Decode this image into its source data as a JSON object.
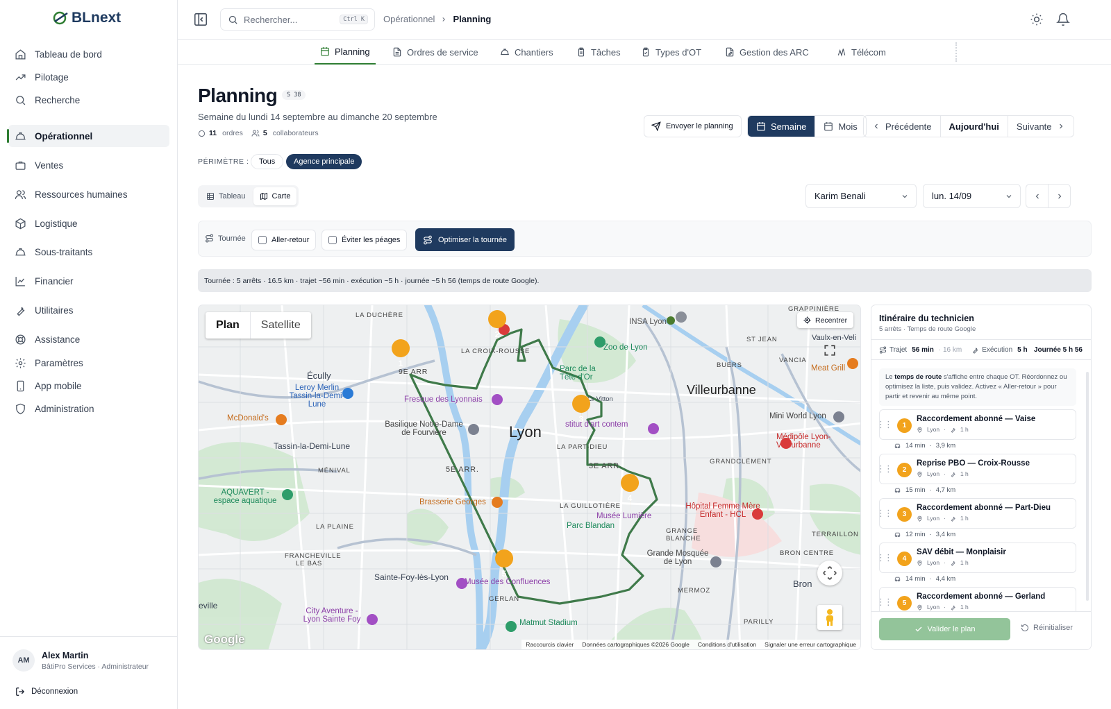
{
  "app": {
    "logo": "BLnext"
  },
  "sidebar": {
    "items": [
      {
        "label": "Tableau de bord",
        "icon": "home-icon"
      },
      {
        "label": "Pilotage",
        "icon": "trending-up-icon"
      },
      {
        "label": "Recherche",
        "icon": "search-icon"
      },
      {
        "label": "Opérationnel",
        "icon": "hard-hat-icon",
        "active": true
      },
      {
        "label": "Ventes",
        "icon": "briefcase-icon"
      },
      {
        "label": "Ressources humaines",
        "icon": "users-icon"
      },
      {
        "label": "Logistique",
        "icon": "package-icon"
      },
      {
        "label": "Sous-traitants",
        "icon": "hard-hat-icon"
      },
      {
        "label": "Financier",
        "icon": "line-chart-icon"
      },
      {
        "label": "Utilitaires",
        "icon": "wrench-icon"
      },
      {
        "label": "Assistance",
        "icon": "lifebuoy-icon"
      },
      {
        "label": "Paramètres",
        "icon": "gear-icon"
      },
      {
        "label": "App mobile",
        "icon": "smartphone-icon"
      },
      {
        "label": "Administration",
        "icon": "shield-icon"
      }
    ],
    "user": {
      "initials": "AM",
      "name": "Alex Martin",
      "role": "BâtiPro Services · Administrateur"
    },
    "logout": "Déconnexion"
  },
  "topbar": {
    "search_placeholder": "Rechercher...",
    "shortcut": "Ctrl K",
    "breadcrumb": [
      "Opérationnel",
      "Planning"
    ]
  },
  "tabs": [
    "Planning",
    "Ordres de service",
    "Chantiers",
    "Tâches",
    "Types d'OT",
    "Gestion des ARC",
    "Télécom"
  ],
  "page": {
    "title": "Planning",
    "week_badge": "S 38",
    "subtitle": "Semaine du lundi 14 septembre au dimanche 20 septembre",
    "orders_count": "11",
    "orders_label": "ordres",
    "collab_count": "5",
    "collab_label": "collaborateurs",
    "perimetre_label": "PÉRIMÈTRE :",
    "perimetre_options": [
      "Tous",
      "Agence principale"
    ],
    "send_button": "Envoyer le planning",
    "view_week": "Semaine",
    "view_month": "Mois",
    "prev": "Précédente",
    "today": "Aujourd'hui",
    "next": "Suivante",
    "display_table": "Tableau",
    "display_map": "Carte",
    "technician": "Karim Benali",
    "day": "lun. 14/09"
  },
  "tour": {
    "label": "Tournée",
    "round_trip": "Aller-retour",
    "avoid_tolls": "Éviter les péages",
    "optimize": "Optimiser la tournée",
    "summary": "Tournée : 5 arrêts · 16.5 km · trajet ~56 min · exécution ~5 h · journée ~5 h 56 (temps de route Google)."
  },
  "map": {
    "type_plan": "Plan",
    "type_satellite": "Satellite",
    "recenter": "Recentrer",
    "google": "Google",
    "attribution": [
      "Raccourcis clavier",
      "Données cartographiques ©2026 Google",
      "Conditions d'utilisation",
      "Signaler une erreur cartographique"
    ],
    "labels": {
      "lyon": "Lyon",
      "villeurbanne": "Villeurbanne",
      "la_duchere": "LA DUCHÈRE",
      "la_croix_rousse": "LA CROIX-ROUSSE",
      "st_jean": "ST JEAN",
      "buers": "BUERS",
      "vancia": "VANCIA",
      "grappiniere": "GRAPPINIÈRE",
      "vaulx": "Vaulx-en-Veli",
      "ecully": "Écully",
      "tassin": "Tassin-la-Demi-Lune",
      "la_part_dieu": "LA PART-DIEU",
      "3e": "3E ARR.",
      "5e": "5E ARR.",
      "menival": "MÉNIVAL",
      "la_plaine": "LA PLAINE",
      "grandclement": "GRANDCLÉMENT",
      "la_guillotiere": "LA GUILLOTIÈRE",
      "grange": "GRANGE BLANCHE",
      "terraillon": "TERRAILLON",
      "bron_centre": "BRON CENTRE",
      "bron": "Bron",
      "mermoz": "MERMOZ",
      "parilly": "PARILLY",
      "francheville": "FRANCHEVILLE LE BAS",
      "sainte_foy": "Sainte-Foy-lès-Lyon",
      "gerland": "GERLAN",
      "ville": "eville",
      "9e": "9E ARR",
      "zoo": "Zoo de Lyon",
      "insa": "INSA Lyon",
      "parc_tete_or": "Parc de la Tête d'Or",
      "meat_grill": "Meat Grill",
      "fresque": "Fresque des Lyonnais",
      "basilique": "Basilique Notre-Dame de Fourvière",
      "leroy": "Leroy Merlin Tassin-la-Demi-Lune",
      "mcdo": "McDonald's",
      "aquavert": "AQUAVERT - espace aquatique",
      "brasserie": "Brasserie Georges",
      "musee_lumiere": "Musée Lumière",
      "parc_blandan": "Parc Blandan",
      "hopital": "Hôpital Femme Mère Enfant - HCL",
      "mosquee": "Grande Mosquée de Lyon",
      "mini_world": "Mini World Lyon",
      "medipole": "Médipôle Lyon-Villeurbanne",
      "musee_conf": "Musée des Confluences",
      "matmut": "Matmut Stadium",
      "city_aventure": "City Aventure - Lyon Sainte Foy",
      "art_contemp": "stitut d'art contem",
      "cr_vitton": "Cr Vitton"
    },
    "stops": [
      "1",
      "2",
      "3",
      "4",
      "5"
    ]
  },
  "panel": {
    "title": "Itinéraire du technicien",
    "subtitle": "5 arrêts · Temps de route Google",
    "trajet_label": "Trajet",
    "trajet_value": "56 min",
    "trajet_km": "· 16 km",
    "exec_label": "Exécution",
    "exec_value": "5 h",
    "journee": "Journée 5 h 56",
    "note_bold": "temps de route",
    "note_pre": "Le ",
    "note_post": " s'affiche entre chaque OT. Réordonnez ou optimisez la liste, puis validez. Activez « Aller-retour » pour partir et revenir au même point.",
    "stops": [
      {
        "n": "1",
        "title": "Raccordement abonné — Vaise",
        "city": "Lyon",
        "dur": "1 h",
        "leg_time": "14 min",
        "leg_km": "3,9 km"
      },
      {
        "n": "2",
        "title": "Reprise PBO — Croix-Rousse",
        "city": "Lyon",
        "dur": "1 h",
        "leg_time": "15 min",
        "leg_km": "4,7 km"
      },
      {
        "n": "3",
        "title": "Raccordement abonné — Part-Dieu",
        "city": "Lyon",
        "dur": "1 h",
        "leg_time": "12 min",
        "leg_km": "3,4 km"
      },
      {
        "n": "4",
        "title": "SAV débit — Monplaisir",
        "city": "Lyon",
        "dur": "1 h",
        "leg_time": "14 min",
        "leg_km": "4,4 km"
      },
      {
        "n": "5",
        "title": "Raccordement abonné — Gerland",
        "city": "Lyon",
        "dur": "1 h"
      }
    ],
    "validate": "Valider le plan",
    "reset": "Réinitialiser"
  },
  "colors": {
    "primary": "#1f3a5f",
    "accent": "#2e7d32",
    "marker": "#f2a31c",
    "route": "#3f7a4a"
  }
}
